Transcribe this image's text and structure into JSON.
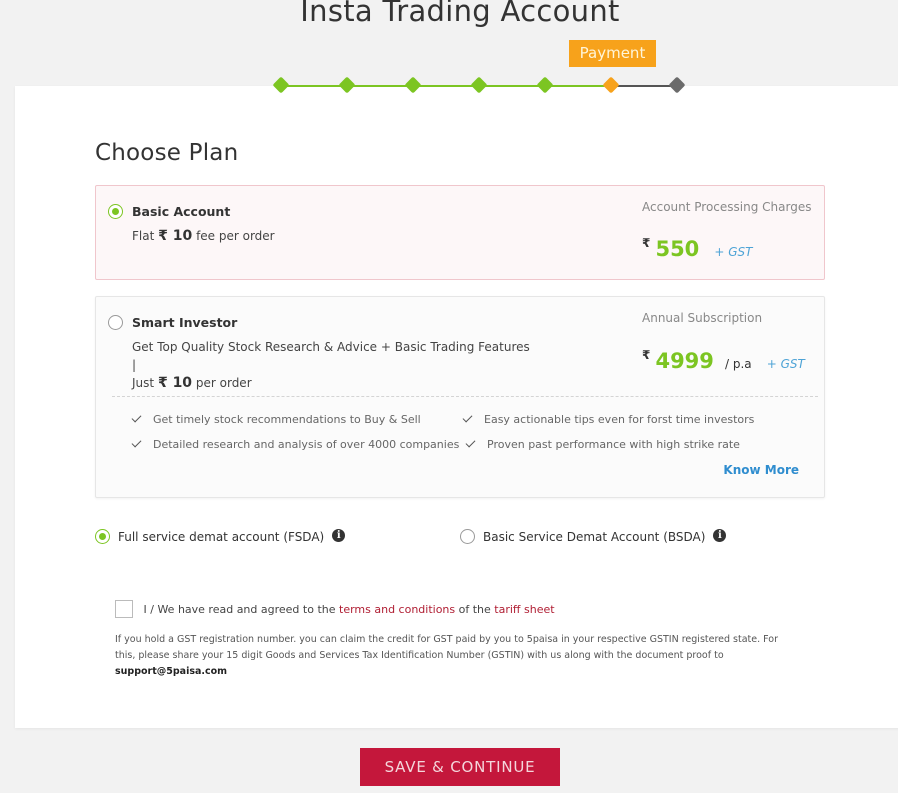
{
  "header": {
    "title": "Insta Trading Account"
  },
  "stepper": {
    "tooltip": "Payment",
    "steps": [
      {
        "status": "done"
      },
      {
        "status": "done"
      },
      {
        "status": "done"
      },
      {
        "status": "done"
      },
      {
        "status": "done"
      },
      {
        "status": "current"
      },
      {
        "status": "todo"
      }
    ],
    "colors": {
      "done": "#7cc522",
      "current": "#f7a21b",
      "todo": "#6b6b6b"
    }
  },
  "choose_plan": {
    "title": "Choose Plan"
  },
  "plans": {
    "basic": {
      "name": "Basic Account",
      "selected": true,
      "desc_prefix": "Flat",
      "desc_currency": "₹",
      "desc_value": "10",
      "desc_suffix": "fee per order",
      "charge_label": "Account Processing Charges",
      "price_currency": "₹",
      "price": "550",
      "price_unit": "",
      "gst": "+ GST"
    },
    "smart": {
      "name": "Smart Investor",
      "selected": false,
      "desc_line1": "Get Top Quality Stock Research & Advice + Basic Trading Features |",
      "desc_prefix": "Just",
      "desc_currency": "₹",
      "desc_value": "10",
      "desc_suffix": "per order",
      "charge_label": "Annual Subscription",
      "price_currency": "₹",
      "price": "4999",
      "price_unit": "/ p.a",
      "gst": "+ GST",
      "features": [
        "Get timely stock recommendations to Buy & Sell",
        "Easy actionable tips even for forst time investors",
        "Detailed research and analysis of over 4000 companies",
        "Proven past performance with high strike rate"
      ],
      "know_more": "Know More"
    }
  },
  "demat": {
    "fsda": {
      "label": "Full service demat account (FSDA)",
      "selected": true
    },
    "bsda": {
      "label": "Basic Service Demat Account (BSDA)",
      "selected": false
    }
  },
  "terms": {
    "prefix": "I / We have read and agreed to the",
    "terms_link": "terms and conditions",
    "middle": "of the",
    "tariff_link": "tariff sheet",
    "checked": false
  },
  "gst_note": {
    "text": "If you hold a GST registration number. you can claim the credit for GST paid by you to 5paisa in your respective GSTIN registered state. For this, please share your 15 digit Goods and Services Tax Identification Number (GSTIN) with us along with the document proof to",
    "email": "support@5paisa.com"
  },
  "actions": {
    "save_label": "SAVE & CONTINUE"
  }
}
